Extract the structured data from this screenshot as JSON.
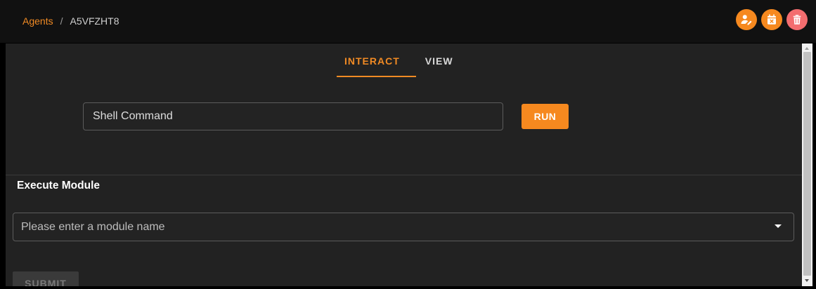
{
  "breadcrumb": {
    "agents_label": "Agents",
    "separator": "/",
    "agent_id": "A5VFZHT8"
  },
  "header_actions": [
    {
      "icon": "user-edit-icon",
      "color": "#f6891f"
    },
    {
      "icon": "calendar-remove-icon",
      "color": "#f6891f"
    },
    {
      "icon": "trash-icon",
      "color": "#f36d6f"
    }
  ],
  "tabs": [
    {
      "label": "INTERACT",
      "active": true
    },
    {
      "label": "VIEW",
      "active": false
    }
  ],
  "shell": {
    "placeholder": "Shell Command",
    "run_label": "RUN"
  },
  "module": {
    "section_title": "Execute Module",
    "placeholder": "Please enter a module name",
    "submit_label": "SUBMIT"
  },
  "colors": {
    "accent": "#f08a24",
    "danger": "#f36d6f",
    "background": "#222222"
  }
}
